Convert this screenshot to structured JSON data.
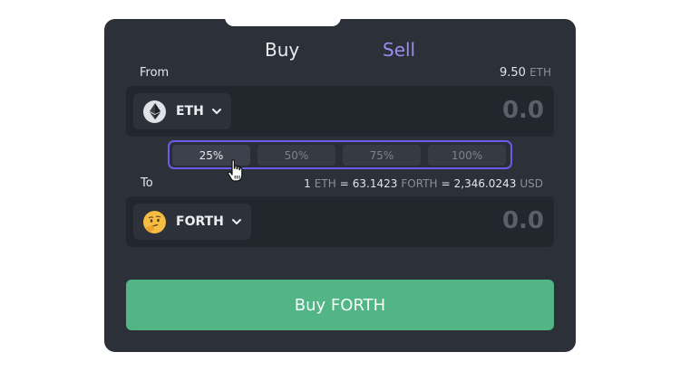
{
  "tabs": {
    "buy": "Buy",
    "sell": "Sell"
  },
  "from": {
    "label": "From",
    "balance_value": "9.50",
    "balance_unit": "ETH",
    "token": "ETH",
    "token_icon": "ethereum-icon",
    "amount": "0.0"
  },
  "percent_options": [
    "25%",
    "50%",
    "75%",
    "100%"
  ],
  "selected_percent": "25%",
  "to": {
    "label": "To",
    "token": "FORTH",
    "token_icon": "thinking-face-icon",
    "amount": "0.0"
  },
  "rate": {
    "one": "1",
    "eth_unit": "ETH",
    "eq1": "=",
    "forth_value": "63.1423",
    "forth_unit": "FORTH",
    "eq2": "=",
    "usd_value": "2,346.0243",
    "usd_unit": "USD"
  },
  "action": {
    "label": "Buy FORTH"
  },
  "colors": {
    "card": "#2c3038",
    "panel": "#22262d",
    "accent_purple": "#6b5ce7",
    "sell_tab": "#9b8cf0",
    "buy_button": "#52b586"
  }
}
